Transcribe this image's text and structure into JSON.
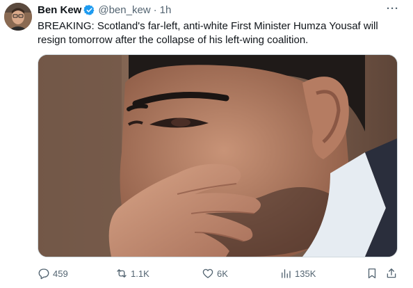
{
  "author": {
    "display_name": "Ben Kew",
    "handle": "@ben_kew",
    "separator": "·",
    "timestamp": "1h",
    "verified_icon": "verified-badge-icon",
    "avatar_icon": "avatar"
  },
  "tweet": {
    "text": "BREAKING: Scotland's far-left, anti-white First Minister Humza Yousaf will resign tomorrow after the collapse of his left-wing coalition."
  },
  "menu": {
    "more_label": "···"
  },
  "actions": {
    "replies": "459",
    "reposts": "1.1K",
    "likes": "6K",
    "views": "135K"
  },
  "colors": {
    "accent": "#1d9bf0",
    "secondary_text": "#536471",
    "primary_text": "#0f1419"
  }
}
